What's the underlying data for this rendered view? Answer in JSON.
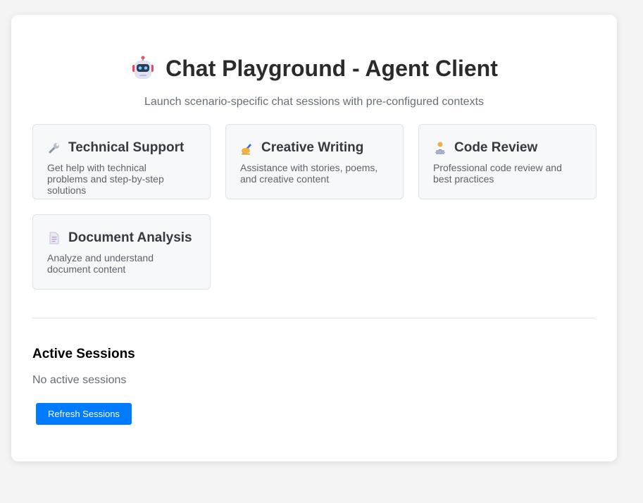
{
  "header": {
    "icon": "robot-icon",
    "title": "Chat Playground - Agent Client",
    "subtitle": "Launch scenario-specific chat sessions with pre-configured contexts"
  },
  "scenarios": [
    {
      "icon": "wrench-icon",
      "title": "Technical Support",
      "description": "Get help with technical problems and step-by-step solutions"
    },
    {
      "icon": "writing-hand-icon",
      "title": "Creative Writing",
      "description": "Assistance with stories, poems, and creative content"
    },
    {
      "icon": "technologist-icon",
      "title": "Code Review",
      "description": "Professional code review and best practices"
    },
    {
      "icon": "document-icon",
      "title": "Document Analysis",
      "description": "Analyze and understand document content"
    }
  ],
  "sessions": {
    "title": "Active Sessions",
    "empty_text": "No active sessions",
    "refresh_label": "Refresh Sessions"
  },
  "colors": {
    "accent": "#007bff",
    "background": "#f4f4f4",
    "card_background": "#f7f8fa"
  }
}
